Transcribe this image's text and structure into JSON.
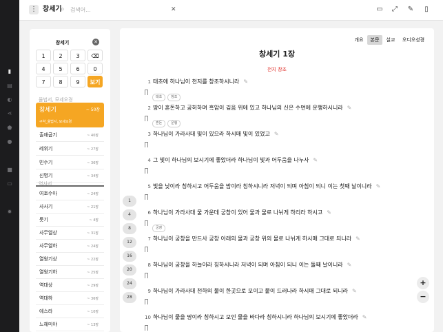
{
  "app_title": "창세기",
  "search": {
    "placeholder": "검색어..."
  },
  "icons": {
    "menu": "menu-dots-icon",
    "search": "search-icon",
    "clear": "close-icon"
  },
  "keypad": {
    "title": "창세기",
    "keys": [
      "1",
      "2",
      "3",
      "⌫",
      "4",
      "5",
      "6",
      "0",
      "7",
      "8",
      "9",
      "보기"
    ]
  },
  "books": {
    "section_label_ot": "율법서, 모세오경",
    "selected": {
      "name": "창세기",
      "count": "~ 50장",
      "sub": "구약_율법서, 모세오경"
    },
    "list_a": [
      {
        "name": "출애굽기",
        "count": "~ 40장"
      },
      {
        "name": "레위기",
        "count": "~ 27장"
      },
      {
        "name": "민수기",
        "count": "~ 36장"
      },
      {
        "name": "신명기",
        "count": "~ 34장"
      }
    ],
    "section_label_history": "역사서",
    "list_b": [
      {
        "name": "여호수아",
        "count": "~ 24장"
      },
      {
        "name": "사사기",
        "count": "~ 21장"
      },
      {
        "name": "룻기",
        "count": "~ 4장"
      },
      {
        "name": "사무엘상",
        "count": "~ 31장"
      },
      {
        "name": "사무엘하",
        "count": "~ 24장"
      },
      {
        "name": "열왕기상",
        "count": "~ 22장"
      },
      {
        "name": "열왕기하",
        "count": "~ 25장"
      },
      {
        "name": "역대상",
        "count": "~ 29장"
      },
      {
        "name": "역대하",
        "count": "~ 36장"
      },
      {
        "name": "에스라",
        "count": "~ 10장"
      },
      {
        "name": "느헤미야",
        "count": "~ 13장"
      }
    ]
  },
  "chapter_chips": [
    "1",
    "4",
    "8",
    "12",
    "16",
    "20",
    "24",
    "28"
  ],
  "tabs": [
    "개요",
    "본문",
    "설교",
    "오디오성경"
  ],
  "active_tab": "본문",
  "chapter_title": "창세기 1장",
  "section_title": "천지 창조",
  "verses": [
    {
      "num": "1",
      "text": "태초에 하나님이 천지를 창조하시니라",
      "tags": [
        "태초",
        "창조"
      ]
    },
    {
      "num": "2",
      "text": "땅이 혼돈하고 공허하며 흑암이 깊음 위에 있고 하나님의 신은 수면에 운행하시니라",
      "tags": [
        "혼돈",
        "운행"
      ]
    },
    {
      "num": "3",
      "text": "하나님이 가라사대 빛이 있으라 하시매 빛이 있었고",
      "tags": []
    },
    {
      "num": "4",
      "text": "그 빛이 하나님의 보시기에 좋았더라 하나님이 빛과 어두움을 나누사",
      "tags": []
    },
    {
      "num": "5",
      "text": "빛을 낮이라 칭하시고 어두움을 밤이라 칭하시니라 저녁이 되며 아침이 되니 이는 첫째 날이니라",
      "tags": []
    },
    {
      "num": "6",
      "text": "하나님이 가라사대 물 가운데 궁창이 있어 물과 물로 나뉘게 하리라 하시고",
      "tags": [
        "궁창"
      ]
    },
    {
      "num": "7",
      "text": "하나님이 궁창을 만드사 궁창 아래의 물과 궁창 위의 물로 나뉘게 하시매 그대로 되니라",
      "tags": []
    },
    {
      "num": "8",
      "text": "하나님이 궁창을 하늘이라 칭하시니라 저녁이 되며 아침이 되니 이는 둘째 날이니라",
      "tags": []
    },
    {
      "num": "9",
      "text": "하나님이 가라사대 천하의 물이 한곳으로 모이고 뭍이 드러나라 하시매 그대로 되니라",
      "tags": []
    },
    {
      "num": "10",
      "text": "하나님이 뭍을 땅이라 칭하시고 모인 물을 바다라 칭하시니라 하나님의 보시기에 좋았더라",
      "tags": []
    }
  ],
  "zoom": {
    "in": "+",
    "out": "−"
  },
  "colors": {
    "accent": "#f5a623",
    "section_red": "#e0312b",
    "rail": "#1c1c1e"
  }
}
